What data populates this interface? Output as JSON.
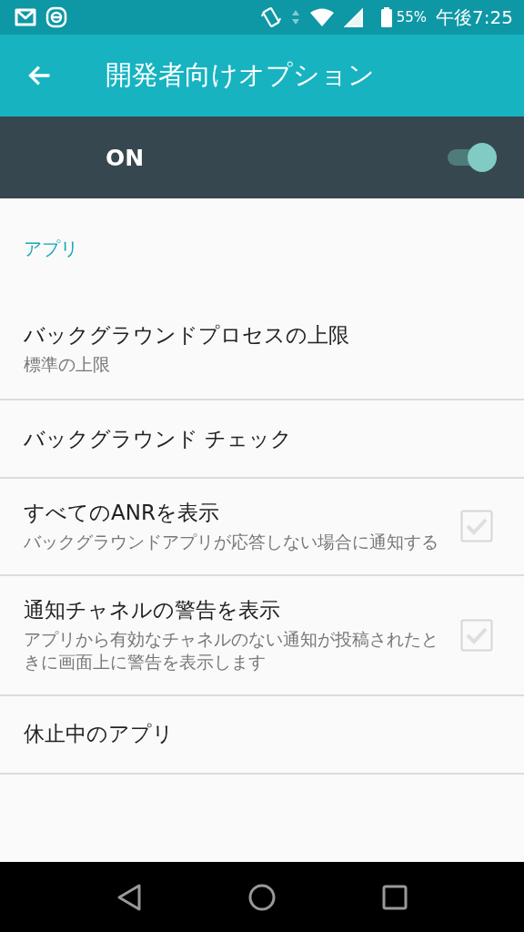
{
  "status_bar": {
    "battery": "55%",
    "time": "午後7:25"
  },
  "app_bar": {
    "title": "開発者向けオプション"
  },
  "master_switch": {
    "label": "ON",
    "on": true
  },
  "section": {
    "title": "アプリ"
  },
  "items": [
    {
      "kind": "text",
      "title": "バックグラウンドプロセスの上限",
      "summary": "標準の上限"
    },
    {
      "kind": "text",
      "title": "バックグラウンド チェック"
    },
    {
      "kind": "checkbox",
      "title": "すべてのANRを表示",
      "summary": "バックグラウンドアプリが応答しない場合に通知する",
      "checked": true,
      "disabled": true
    },
    {
      "kind": "checkbox",
      "title": "通知チャネルの警告を表示",
      "summary": "アプリから有効なチャネルのない通知が投稿されたときに画面上に警告を表示します",
      "checked": true,
      "disabled": true
    },
    {
      "kind": "text",
      "title": "休止中のアプリ"
    },
    {
      "kind": "empty"
    }
  ]
}
